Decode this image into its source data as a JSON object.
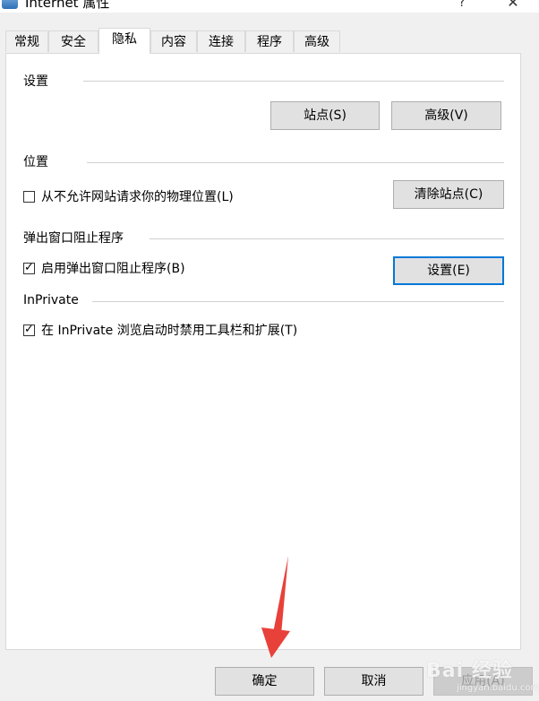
{
  "window": {
    "title": "Internet 属性",
    "help": "?",
    "close": "✕"
  },
  "tabs": [
    "常规",
    "安全",
    "隐私",
    "内容",
    "连接",
    "程序",
    "高级"
  ],
  "active_tab": "隐私",
  "settings": {
    "label": "设置",
    "sites_button": "站点(S)",
    "advanced_button": "高级(V)"
  },
  "location": {
    "label": "位置",
    "checkbox_label": "从不允许网站请求你的物理位置(L)",
    "checked": false,
    "clear_sites_button": "清除站点(C)"
  },
  "popup": {
    "label": "弹出窗口阻止程序",
    "checkbox_label": "启用弹出窗口阻止程序(B)",
    "checked": true,
    "settings_button": "设置(E)"
  },
  "inprivate": {
    "label": "InPrivate",
    "checkbox_label": "在 InPrivate 浏览启动时禁用工具栏和扩展(T)",
    "checked": true
  },
  "footer": {
    "ok_button": "确定",
    "cancel_button": "取消",
    "apply_button": "应用(A)"
  },
  "watermark": {
    "brand": "Bai 经验",
    "url": "jingyan.baidu.com"
  },
  "colors": {
    "accent": "#0078d7",
    "arrow": "#e8413a"
  }
}
